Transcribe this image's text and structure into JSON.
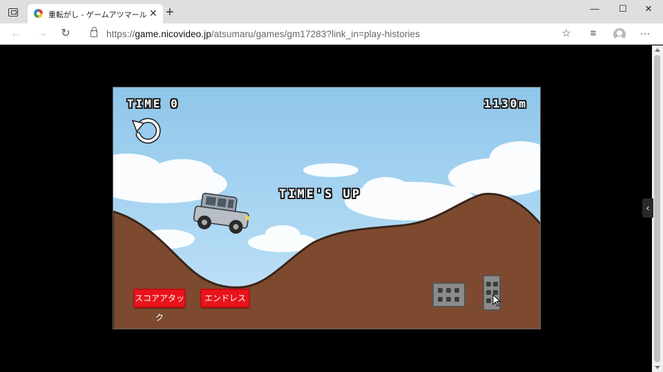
{
  "browser": {
    "tab": {
      "title": "重転がし - ゲームアツマール",
      "close": "✕"
    },
    "new_tab": "+",
    "window": {
      "minimize": "—",
      "maximize": "☐",
      "close": "✕"
    },
    "nav": {
      "back": "←",
      "forward": "→",
      "reload": "↻"
    },
    "address": {
      "host": "game.nicovideo.jp",
      "path": "/atsumaru/games/gm17283?link_in=play-histories",
      "scheme": "https://"
    },
    "toolbar": {
      "add_favorite": "☆",
      "favorites": "≡",
      "more": "···"
    },
    "side_toggle": "‹"
  },
  "game": {
    "time_label": "TIME 0",
    "distance": "1130m",
    "message": "TIME'S UP",
    "buttons": {
      "score_attack": "スコアアタック",
      "endless": "エンドレス"
    },
    "colors": {
      "sky": "#a6d3f1",
      "ground": "#7d4a30",
      "button": "#e8141c"
    }
  }
}
